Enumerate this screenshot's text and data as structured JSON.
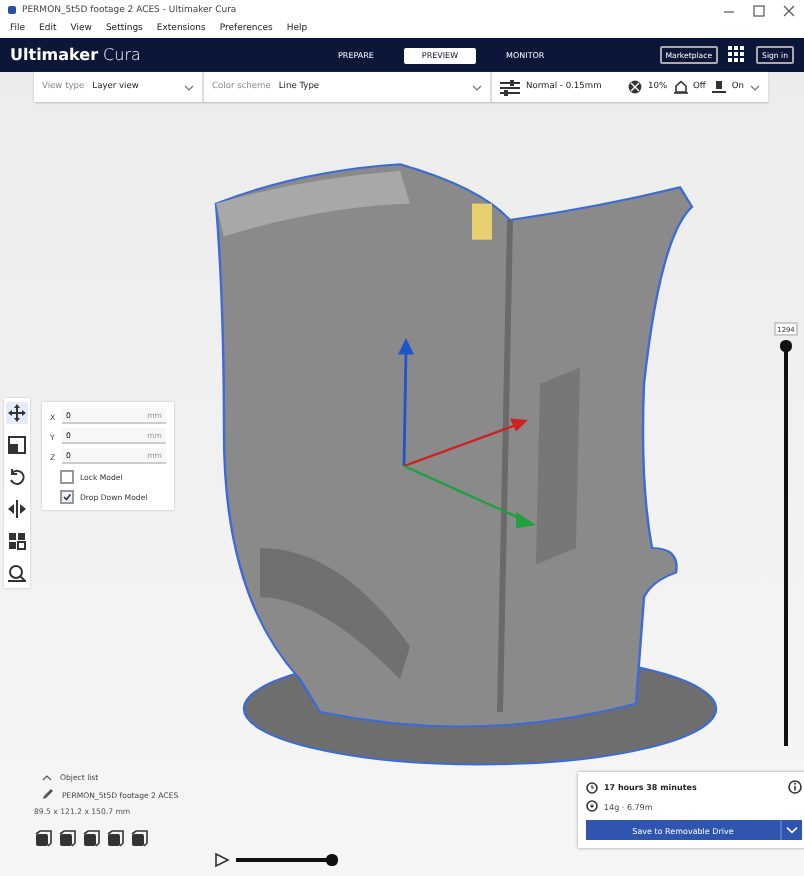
{
  "window": {
    "title": "PERMON_5t5D footage 2 ACES - Ultimaker Cura"
  },
  "menu": [
    "File",
    "Edit",
    "View",
    "Settings",
    "Extensions",
    "Preferences",
    "Help"
  ],
  "header": {
    "logo_bold": "Ultimaker",
    "logo_light": "Cura",
    "stages": [
      {
        "label": "PREPARE",
        "selected": false
      },
      {
        "label": "PREVIEW",
        "selected": true
      },
      {
        "label": "MONITOR",
        "selected": false
      }
    ],
    "marketplace": "Marketplace",
    "sign_in": "Sign in"
  },
  "toolbar": {
    "view_type_label": "View type",
    "view_type": "Layer view",
    "color_scheme_label": "Color scheme",
    "color_scheme": "Line Type",
    "profile": "Normal - 0.15mm",
    "infill": "10%",
    "support": "Off",
    "adhesion": "On"
  },
  "tools": [
    {
      "kind": "move",
      "selected": true
    },
    {
      "kind": "scale",
      "selected": false
    },
    {
      "kind": "rotate",
      "selected": false
    },
    {
      "kind": "mirror",
      "selected": false
    },
    {
      "kind": "per-model",
      "selected": false
    },
    {
      "kind": "support-blocker",
      "selected": false
    }
  ],
  "move_panel": {
    "fields": [
      {
        "axis": "X",
        "value": "0",
        "unit": "mm"
      },
      {
        "axis": "Y",
        "value": "0",
        "unit": "mm"
      },
      {
        "axis": "Z",
        "value": "0",
        "unit": "mm"
      }
    ],
    "options": [
      {
        "label": "Lock Model",
        "checked": false
      },
      {
        "label": "Drop Down Model",
        "checked": true
      }
    ]
  },
  "layer_slider": {
    "reading": "1294",
    "level": 1
  },
  "object_info": {
    "object_list": "Object list",
    "name": "PERMON_5t5D footage 2 ACES",
    "dimensions": "89.5 x 121.2 x 150.7 mm"
  },
  "playback": {
    "level": 1
  },
  "print_panel": {
    "time": "17 hours 38 minutes",
    "material": "14g · 6.79m",
    "button": "Save to Removable Drive"
  }
}
